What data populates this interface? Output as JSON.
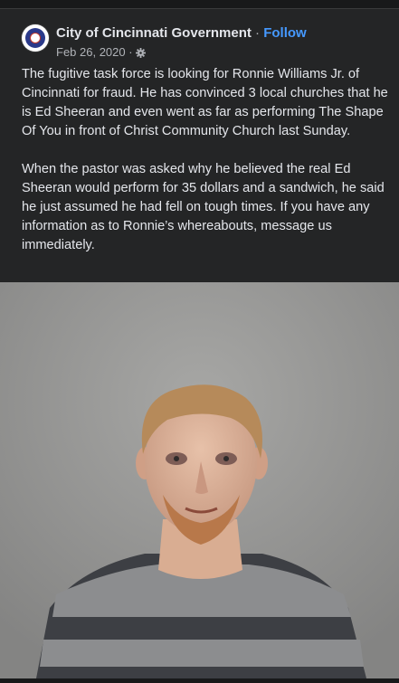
{
  "page": {
    "name": "City of Cincinnati Government",
    "separator": "·",
    "follow_label": "Follow",
    "date": "Feb 26, 2020",
    "date_separator": "·",
    "privacy_icon": "gear-icon"
  },
  "post": {
    "paragraph_1": "The fugitive task force is looking for Ronnie Williams Jr. of Cincinnati for fraud. He has convinced 3 local churches that he is Ed Sheeran and even went as far as performing The Shape Of You in front of Christ Community Church last Sunday.",
    "paragraph_2": "When the pastor was asked why he believed the real Ed Sheeran would perform for 35 dollars and a sandwich, he said he just assumed he had fell on tough times. If you have any information as to Ronnie’s whereabouts, message us immediately."
  },
  "colors": {
    "background": "#242526",
    "text": "#e4e6eb",
    "secondary_text": "#b0b3b8",
    "link": "#4599ff"
  }
}
